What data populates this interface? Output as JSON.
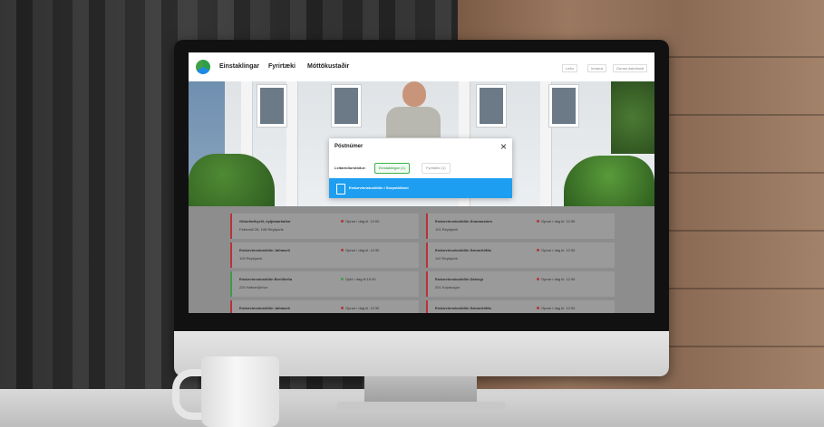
{
  "nav": {
    "items": [
      "Einstaklingar",
      "Fyrirtæki",
      "Móttökustaðir"
    ],
    "right_buttons": [
      "Leita",
      "Innskrá",
      "Gerast áskrifandi"
    ]
  },
  "modal": {
    "title": "Póstnúmer",
    "close_symbol": "×",
    "label": "Leitarniðurstöður:",
    "filters": [
      "Einstaklingar (1)",
      "Fyrirtæki (1)"
    ],
    "result_text": "Endurvinnslustöðin í Sorpstöðinni"
  },
  "locations": [
    {
      "name": "Göturfaribyrði, nytjamarkaður",
      "address": "Fellsmúli 28, 108 Reykjavík",
      "status": "Opnar í dag kl. 12:00",
      "status_color": "#b8323a"
    },
    {
      "name": "Endurvinnslustöðin Ánanaustum",
      "address": "101 Reykjavík",
      "status": "Opnar í dag kl. 12:30",
      "status_color": "#b8323a"
    },
    {
      "name": "Endurvinnslustöðin Jafnaseli",
      "address": "109 Reykjavík",
      "status": "Opnar í dag kl. 12:30",
      "status_color": "#b8323a"
    },
    {
      "name": "Endurvinnslustöðin Sævarhöfða",
      "address": "110 Reykjavík",
      "status": "Opnar í dag kl. 12:30",
      "status_color": "#b8323a"
    },
    {
      "name": "Endurvinnslustöðin Breiðhellu",
      "address": "220 Hafnarfjörður",
      "status": "Opið í dag til 19:30",
      "status_color": "#3e9a48"
    },
    {
      "name": "Endurvinnslustöðin Dalvegi",
      "address": "201 Kópavogur",
      "status": "Opnar í dag kl. 12:30",
      "status_color": "#b8323a"
    },
    {
      "name": "Endurvinnslustöðin Jafnaseli",
      "address": "",
      "status": "Opnar í dag kl. 12:30",
      "status_color": "#b8323a"
    },
    {
      "name": "Endurvinnslustöðin Sævarhöfða",
      "address": "",
      "status": "Opnar í dag kl. 12:30",
      "status_color": "#b8323a"
    }
  ]
}
